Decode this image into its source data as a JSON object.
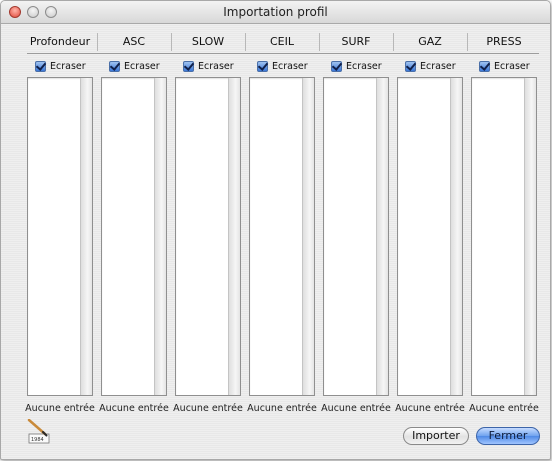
{
  "window": {
    "title": "Importation profil"
  },
  "columns": [
    {
      "header": "Profondeur",
      "checkbox_label": "Ecraser",
      "checked": true,
      "empty_text": "Aucune entrée"
    },
    {
      "header": "ASC",
      "checkbox_label": "Ecraser",
      "checked": true,
      "empty_text": "Aucune entrée"
    },
    {
      "header": "SLOW",
      "checkbox_label": "Ecraser",
      "checked": true,
      "empty_text": "Aucune entrée"
    },
    {
      "header": "CEIL",
      "checkbox_label": "Ecraser",
      "checked": true,
      "empty_text": "Aucune entrée"
    },
    {
      "header": "SURF",
      "checkbox_label": "Ecraser",
      "checked": true,
      "empty_text": "Aucune entrée"
    },
    {
      "header": "GAZ",
      "checkbox_label": "Ecraser",
      "checked": true,
      "empty_text": "Aucune entrée"
    },
    {
      "header": "PRESS",
      "checkbox_label": "Ecraser",
      "checked": true,
      "empty_text": "Aucune entrée"
    }
  ],
  "buttons": {
    "import_label": "Importer",
    "close_label": "Fermer"
  },
  "app_icon": {
    "name": "notebook-pen-icon",
    "label": "1984"
  },
  "colors": {
    "default_button": "#5b92ea",
    "checkbox": "#3b78d8"
  }
}
